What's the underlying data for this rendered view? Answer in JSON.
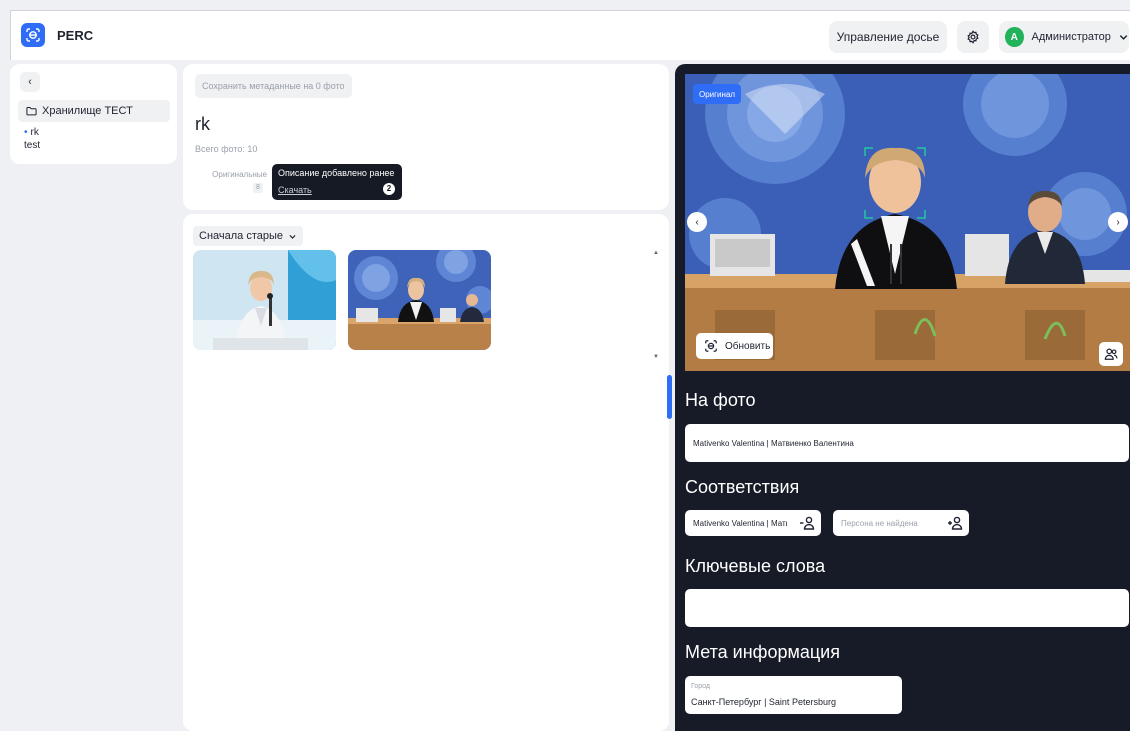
{
  "header": {
    "brand": "PERC",
    "dossier_button": "Управление досье",
    "user_initial": "A",
    "user_name": "Администратор"
  },
  "sidebar": {
    "back_label": "‹",
    "storage_label": "Хранилище ТЕСТ",
    "items": [
      {
        "label": "rk"
      },
      {
        "label": "test"
      }
    ]
  },
  "album": {
    "save_meta_button": "Сохранить метаданные на 0 фото",
    "title": "rk",
    "total": "Всего фото: 10",
    "filter_original": "Оригинальные",
    "filter_original_count": "8",
    "tooltip": {
      "title": "Описание добавлено ранее",
      "link": "Скачать",
      "count": "2"
    },
    "sort_label": "Сначала старые"
  },
  "viewer": {
    "original_badge": "Оригинал",
    "refresh_button": "Обновить",
    "on_photo_title": "На фото",
    "on_photo_value": "Mativenko Valentina | Матвиенко Валентина",
    "matches_title": "Соответствия",
    "matches": [
      {
        "label": "Mativenko Valentina | Матвиенко Валентина"
      },
      {
        "label": "Персона не найдена"
      }
    ],
    "keywords_title": "Ключевые слова",
    "keywords_value": "",
    "meta_title": "Мета информация",
    "city_label": "Город",
    "city_value": "Санкт-Петербург | Saint Petersburg"
  },
  "colors": {
    "accent": "#2f6df6",
    "dark_panel": "#171b27",
    "avatar": "#22b35a"
  }
}
